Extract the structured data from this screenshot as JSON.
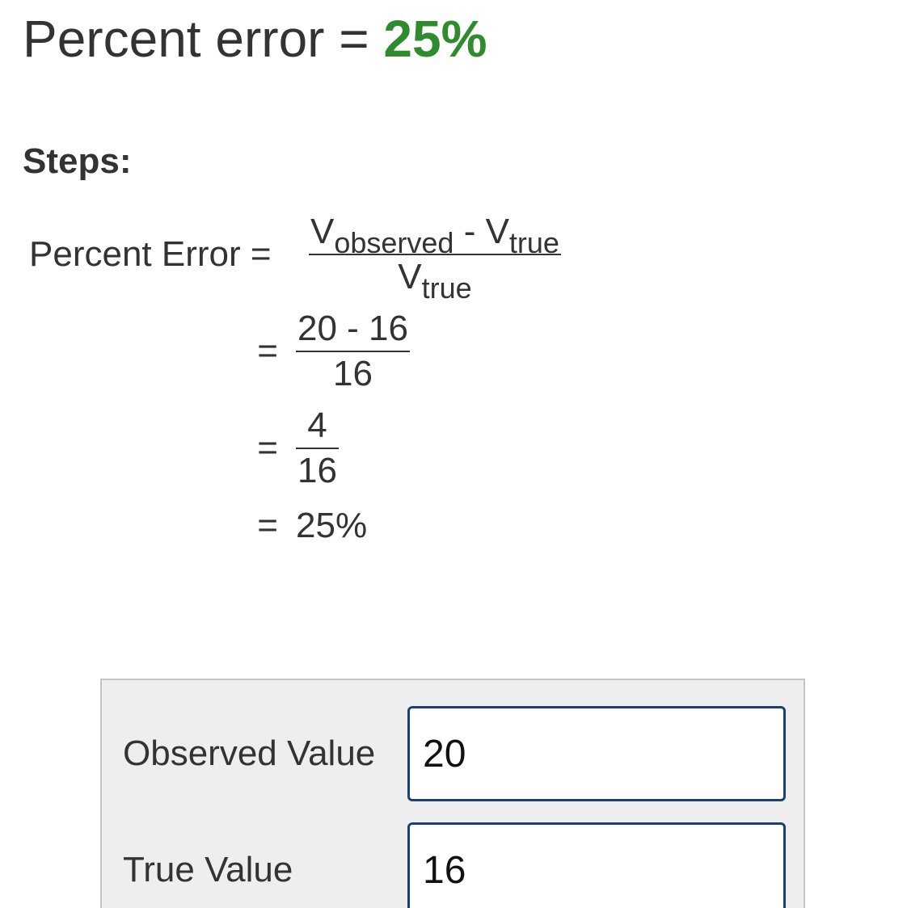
{
  "result": {
    "label": "Percent error = ",
    "value": "25%"
  },
  "steps": {
    "heading": "Steps:",
    "formula_lhs": "Percent Error =",
    "numerator_v1": "V",
    "numerator_sub1": "observed",
    "numerator_minus": " - V",
    "numerator_sub2": "true",
    "denominator_v": "V",
    "denominator_sub": "true",
    "eq": "=",
    "step2_numerator": "20 - 16",
    "step2_denominator": "16",
    "step3_numerator": "4",
    "step3_denominator": "16",
    "final_value": "25%"
  },
  "form": {
    "observed_label": "Observed Value",
    "observed_value": "20",
    "true_label": "True Value",
    "true_value": "16"
  },
  "colors": {
    "result_value": "#2e8b2e",
    "input_border": "#1c3f78",
    "panel_background": "#eeeeee"
  }
}
